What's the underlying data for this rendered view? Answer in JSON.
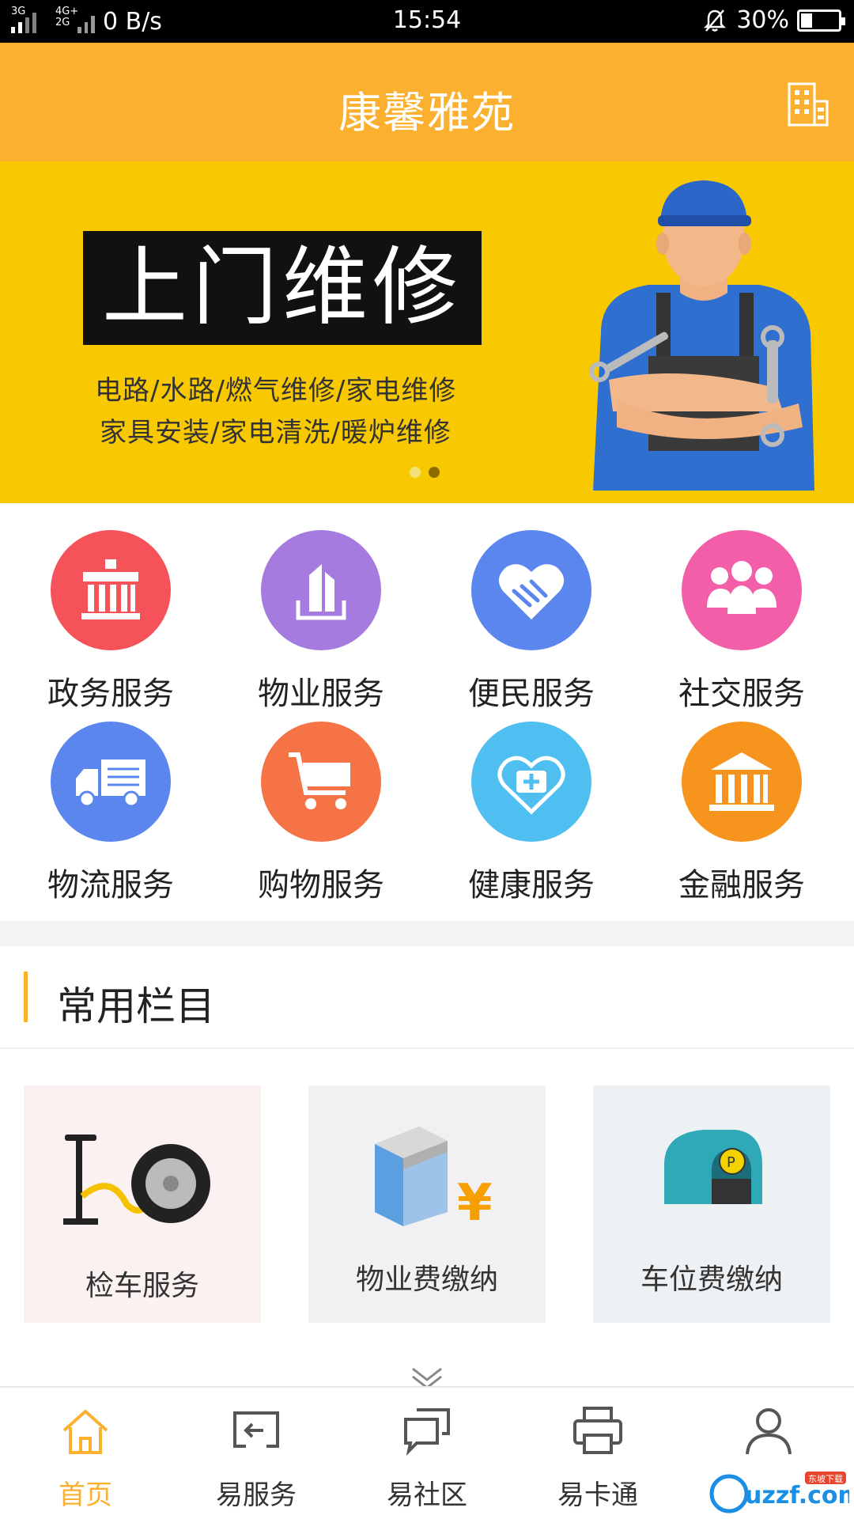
{
  "status_bar": {
    "net1": "3G",
    "net2": "4G+",
    "net3": "2G",
    "speed": "0 B/s",
    "time": "15:54",
    "battery": "30%",
    "battery_level": 0.3
  },
  "header": {
    "title": "康馨雅苑",
    "right_icon": "building-icon"
  },
  "banner": {
    "headline": "上门维修",
    "line1": "电路/水路/燃气维修/家电维修",
    "line2": "家具安装/家电清洗/暖炉维修",
    "slide_count": 2,
    "active_slide": 2
  },
  "services": [
    {
      "label": "政务服务",
      "icon": "government-building-icon",
      "color": "#f5525a"
    },
    {
      "label": "物业服务",
      "icon": "tower-building-icon",
      "color": "#a57be0"
    },
    {
      "label": "便民服务",
      "icon": "handshake-heart-icon",
      "color": "#5b86ee"
    },
    {
      "label": "社交服务",
      "icon": "people-group-icon",
      "color": "#f25ea8"
    },
    {
      "label": "物流服务",
      "icon": "delivery-truck-icon",
      "color": "#5b86ee"
    },
    {
      "label": "购物服务",
      "icon": "shopping-cart-icon",
      "color": "#f57345"
    },
    {
      "label": "健康服务",
      "icon": "medical-heart-icon",
      "color": "#4fbef0"
    },
    {
      "label": "金融服务",
      "icon": "bank-icon",
      "color": "#f7941d"
    }
  ],
  "common_section": {
    "title": "常用栏目",
    "cards": [
      {
        "label": "检车服务",
        "icon": "tire-pump-icon"
      },
      {
        "label": "物业费缴纳",
        "icon": "building-yen-icon"
      },
      {
        "label": "车位费缴纳",
        "icon": "parking-garage-icon"
      }
    ]
  },
  "bottom_nav": [
    {
      "label": "首页",
      "icon": "home-icon"
    },
    {
      "label": "易服务",
      "icon": "service-return-icon"
    },
    {
      "label": "易社区",
      "icon": "chat-bubbles-icon"
    },
    {
      "label": "易卡通",
      "icon": "printer-icon"
    },
    {
      "label": "",
      "icon": "user-icon"
    }
  ],
  "watermark": {
    "text": "uzzf.com",
    "sub": "东坡下载"
  },
  "colors": {
    "accent": "#fbb12f",
    "banner_bg": "#f8c900"
  }
}
